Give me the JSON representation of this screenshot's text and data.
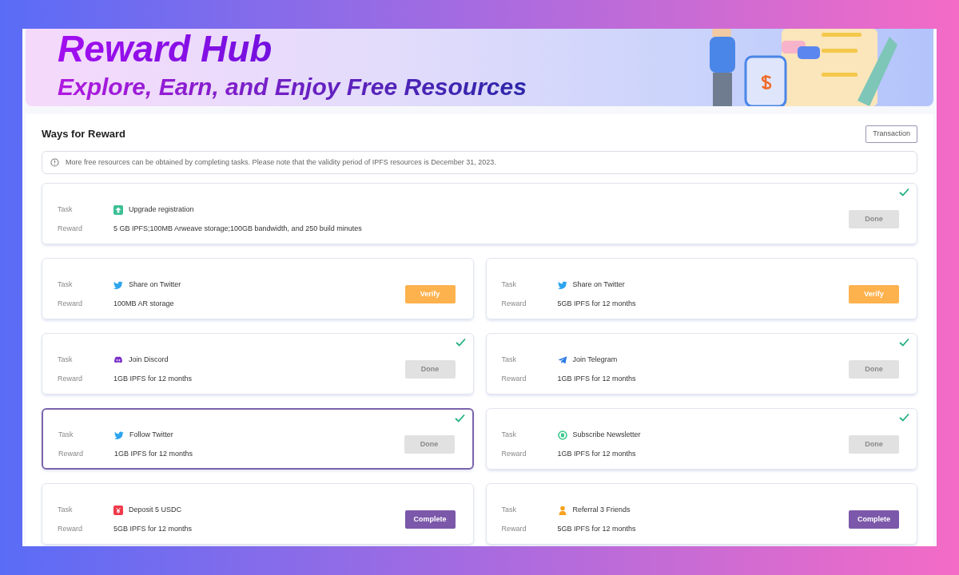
{
  "banner": {
    "title": "Reward Hub",
    "subtitle": "Explore, Earn, and Enjoy Free Resources"
  },
  "section": {
    "title": "Ways for Reward",
    "action": "Transaction"
  },
  "notice": "More free resources can be obtained by completing tasks. Please note that the validity period of IPFS resources is December 31, 2023.",
  "featured_task": {
    "kind": "upgrade",
    "task_label": "Task",
    "task": "Upgrade registration",
    "reward_label": "Reward",
    "reward": "5 GB IPFS;100MB Arweave storage;100GB bandwidth, and 250 build minutes",
    "button": {
      "kind": "done",
      "label": "Done"
    },
    "completed": true,
    "selected": false
  },
  "tasks": [
    {
      "kind": "twitter",
      "task_label": "Task",
      "task": "Share on Twitter",
      "reward_label": "Reward",
      "reward": "100MB AR storage",
      "button": {
        "kind": "verify",
        "label": "Verify"
      },
      "completed": false,
      "selected": false
    },
    {
      "kind": "twitter",
      "task_label": "Task",
      "task": "Share on Twitter",
      "reward_label": "Reward",
      "reward": "5GB IPFS for 12 months",
      "button": {
        "kind": "verify",
        "label": "Verify"
      },
      "completed": false,
      "selected": false
    },
    {
      "kind": "discord",
      "task_label": "Task",
      "task": "Join Discord",
      "reward_label": "Reward",
      "reward": "1GB IPFS for 12 months",
      "button": {
        "kind": "done",
        "label": "Done"
      },
      "completed": true,
      "selected": false
    },
    {
      "kind": "telegram",
      "task_label": "Task",
      "task": "Join Telegram",
      "reward_label": "Reward",
      "reward": "1GB IPFS for 12 months",
      "button": {
        "kind": "done",
        "label": "Done"
      },
      "completed": true,
      "selected": false
    },
    {
      "kind": "twitter",
      "task_label": "Task",
      "task": "Follow Twitter",
      "reward_label": "Reward",
      "reward": "1GB IPFS for 12 months",
      "button": {
        "kind": "done",
        "label": "Done"
      },
      "completed": true,
      "selected": true
    },
    {
      "kind": "newsletter",
      "task_label": "Task",
      "task": "Subscribe Newsletter",
      "reward_label": "Reward",
      "reward": "1GB IPFS for 12 months",
      "button": {
        "kind": "done",
        "label": "Done"
      },
      "completed": true,
      "selected": false
    },
    {
      "kind": "deposit",
      "task_label": "Task",
      "task": "Deposit 5 USDC",
      "reward_label": "Reward",
      "reward": "5GB IPFS for 12 months",
      "button": {
        "kind": "complete",
        "label": "Complete"
      },
      "completed": false,
      "selected": false
    },
    {
      "kind": "referral",
      "task_label": "Task",
      "task": "Referral 3 Friends",
      "reward_label": "Reward",
      "reward": "5GB IPFS for 12 months",
      "button": {
        "kind": "complete",
        "label": "Complete"
      },
      "completed": false,
      "selected": false
    }
  ]
}
